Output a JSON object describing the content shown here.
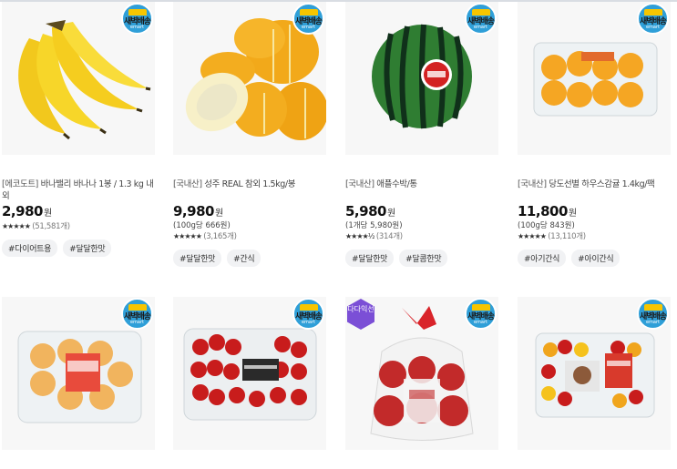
{
  "badge": {
    "text": "새벽배송",
    "sub": "emart"
  },
  "products": [
    {
      "shop": "[에코도트]",
      "name": "바나밸리 바나나 1봉 / 1.3 kg 내외",
      "price": "2,980",
      "won": "원",
      "unit": "",
      "stars": "★★★★★",
      "reviews": "(51,581개)",
      "tags": [
        "#다이어트용",
        "#달달한맛"
      ]
    },
    {
      "shop": "[국내산]",
      "name": "성주 REAL 참외 1.5kg/봉",
      "price": "9,980",
      "won": "원",
      "unit": "(100g당 666원)",
      "stars": "★★★★★",
      "reviews": "(3,165개)",
      "tags": [
        "#달달한맛",
        "#간식"
      ]
    },
    {
      "shop": "[국내산]",
      "name": "애플수박/통",
      "price": "5,980",
      "won": "원",
      "unit": "(1개당 5,980원)",
      "stars": "★★★★½",
      "reviews": "(314개)",
      "tags": [
        "#달달한맛",
        "#달콤한맛"
      ]
    },
    {
      "shop": "[국내산]",
      "name": "당도선별 하우스감귤 1.4kg/팩",
      "price": "11,800",
      "won": "원",
      "unit": "(100g당 843원)",
      "stars": "★★★★★",
      "reviews": "(13,110개)",
      "tags": [
        "#아기간식",
        "#아이간식"
      ]
    }
  ],
  "bottom_row": {
    "deal_badge": "다다익선"
  }
}
